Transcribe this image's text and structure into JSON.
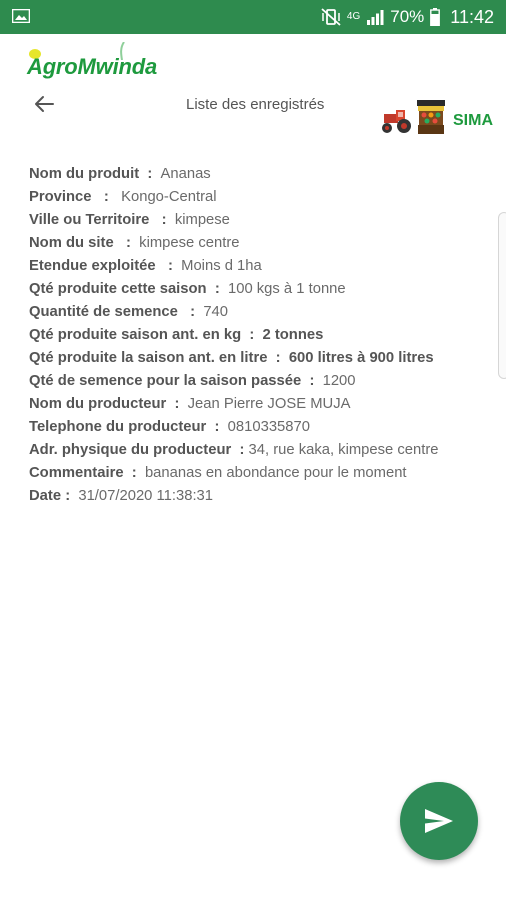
{
  "status_bar": {
    "gallery_icon": "image-icon",
    "mute_icon": "vibrate-mute-icon",
    "network": "4G",
    "signal_icon": "signal-icon",
    "battery": "70%",
    "battery_icon": "battery-icon",
    "time": "11:42"
  },
  "header": {
    "logo_text": "AgroMwinda",
    "back_icon": "arrow-back-icon",
    "title": "Liste des enregistrés",
    "partner_logo_text": "SIMA"
  },
  "details": [
    {
      "label": "Nom du produit",
      "sep": "  :  ",
      "value": "Ananas",
      "bold": false
    },
    {
      "label": "Province",
      "sep": "   :   ",
      "value": "Kongo-Central",
      "bold": false
    },
    {
      "label": "Ville ou Territoire",
      "sep": "   :  ",
      "value": "kimpese",
      "bold": false
    },
    {
      "label": "Nom du site",
      "sep": "   :  ",
      "value": "kimpese centre",
      "bold": false
    },
    {
      "label": "Etendue exploitée",
      "sep": "   :  ",
      "value": "Moins d 1ha",
      "bold": false
    },
    {
      "label": "Qté produite cette saison",
      "sep": "  :  ",
      "value": "100 kgs à 1 tonne",
      "bold": false
    },
    {
      "label": "Quantité de semence",
      "sep": "   :  ",
      "value": "740",
      "bold": false
    },
    {
      "label": "Qté produite saison ant. en kg",
      "sep": "  :  ",
      "value": "2 tonnes",
      "bold": true
    },
    {
      "label": "Qté produite la saison ant. en litre",
      "sep": "  :  ",
      "value": "600 litres à 900 litres",
      "bold": true
    },
    {
      "label": "Qté de semence pour la saison passée",
      "sep": "  :  ",
      "value": "1200",
      "bold": false
    },
    {
      "label": "Nom du producteur",
      "sep": "  :  ",
      "value": "Jean Pierre JOSE MUJA",
      "bold": false
    },
    {
      "label": "Telephone du producteur",
      "sep": "  :  ",
      "value": "0810335870",
      "bold": false
    },
    {
      "label": "Adr. physique du producteur",
      "sep": "  : ",
      "value": "34, rue kaka, kimpese centre",
      "bold": false
    },
    {
      "label": "Commentaire",
      "sep": "  :  ",
      "value": "bananas en abondance pour le moment",
      "bold": false
    },
    {
      "label": "Date",
      "sep": " :  ",
      "value": "31/07/2020 11:38:31",
      "bold": false
    }
  ],
  "fab": {
    "icon": "send-icon"
  },
  "colors": {
    "primary": "#2e8b4e",
    "logo_green": "#1e9a3e",
    "fab": "#2e8b57"
  }
}
